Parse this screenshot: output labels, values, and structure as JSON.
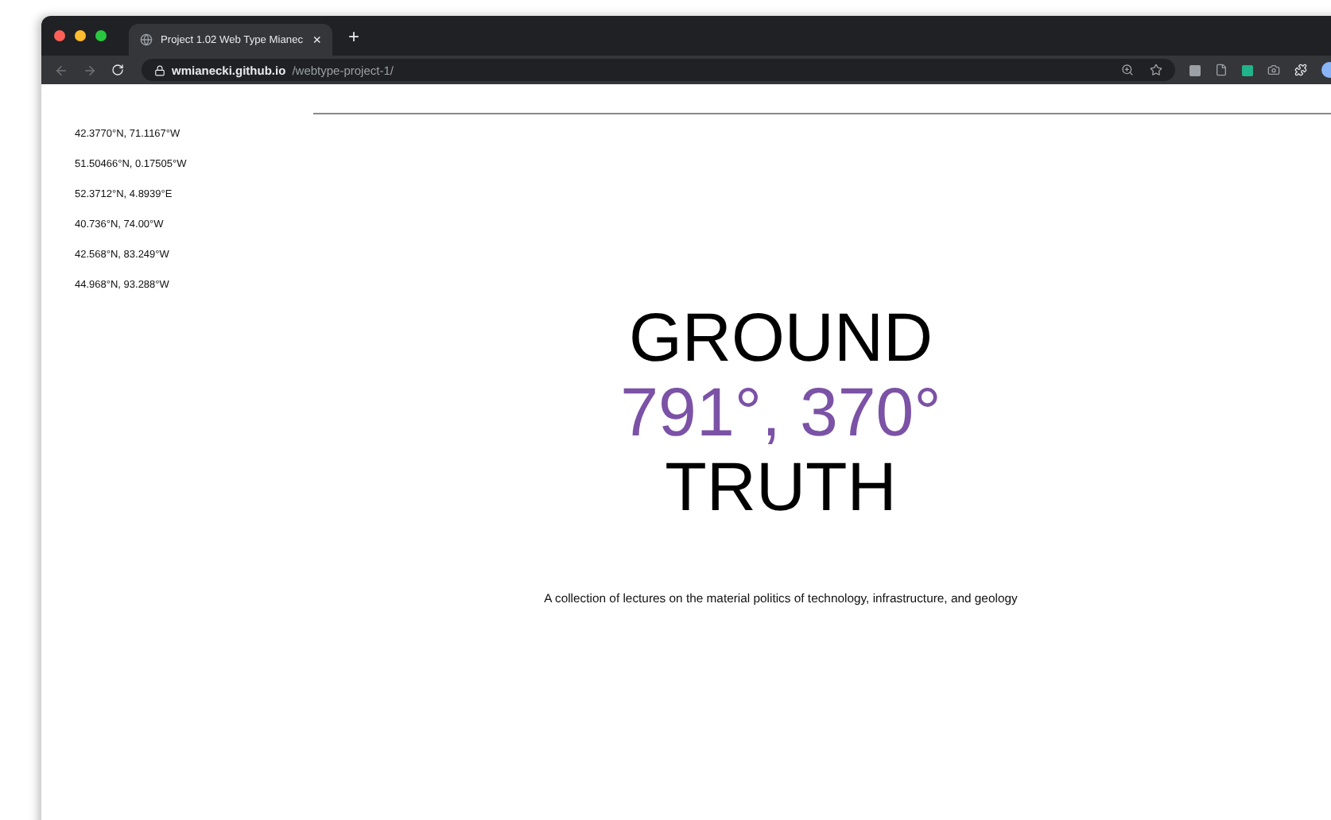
{
  "browser": {
    "tab": {
      "title": "Project 1.02 Web Type Mianec",
      "close": "×"
    },
    "new_tab": "+",
    "url": {
      "host": "wmianecki.github.io",
      "path": "/webtype-project-1/"
    }
  },
  "coordinates": [
    "42.3770°N, 71.1167°W",
    "51.50466°N, 0.17505°W",
    "52.3712°N, 4.8939°E",
    "40.736°N, 74.00°W",
    "42.568°N, 83.249°W",
    "44.968°N, 93.288°W"
  ],
  "title": {
    "lines": [
      {
        "text": "GROUND",
        "kind": "plain"
      },
      {
        "text": "791°, 370°",
        "kind": "accent"
      },
      {
        "text": "TRUTH",
        "kind": "plain"
      }
    ]
  },
  "caption": "A collection of lectures on the material politics of technology, infrastructure, and geology"
}
